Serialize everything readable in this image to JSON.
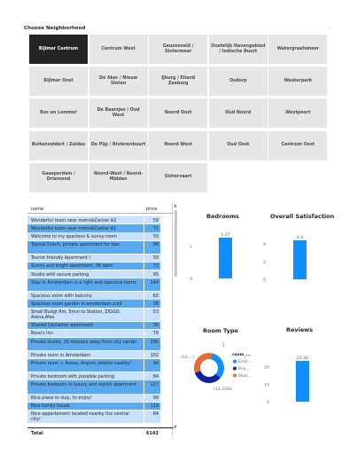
{
  "slicer": {
    "title": "Choose Neighborhood",
    "chevron": "⌵",
    "tiles": [
      {
        "label": "Bijlmer Centrum",
        "selected": true
      },
      {
        "label": "Centrum West"
      },
      {
        "label": "Geuzenveld / Slotermeer"
      },
      {
        "label": "Oostelijk Havengebied / Indische Buurt"
      },
      {
        "label": "Watergraafsmeer"
      },
      {
        "label": "Bijlmer Oost"
      },
      {
        "label": "De Aker / Nieuw Sloten"
      },
      {
        "label": "IJburg / Eiland Zeeburg"
      },
      {
        "label": "Osdorp"
      },
      {
        "label": "Westerpark"
      },
      {
        "label": "Bos en Lommer"
      },
      {
        "label": "De Baarsjes / Oud West"
      },
      {
        "label": "Noord Oost"
      },
      {
        "label": "Oud Noord"
      },
      {
        "label": "Westpoort"
      },
      {
        "label": "Buitenveldert / Zuidas"
      },
      {
        "label": "De Pijp / Rivierenbuurt"
      },
      {
        "label": "Noord West"
      },
      {
        "label": "Oud Oost"
      },
      {
        "label": "Centrum Oost"
      },
      {
        "label": "Gaasperdam / Driemond"
      },
      {
        "label": "Noord-West / Noord-Midden"
      },
      {
        "label": "Slotervaart"
      }
    ]
  },
  "table": {
    "col_name": "name",
    "col_price": "price",
    "rows": [
      {
        "name": "Wonderful room near metro&Center A2",
        "price": "59"
      },
      {
        "name": "Wonderful room near metro&Center A1",
        "price": "71"
      },
      {
        "name": "Welcome to my spacious & sunny room",
        "price": "59"
      },
      {
        "name": "Typical Dutch, private apartment for two.",
        "price": "96"
      },
      {
        "name": "Tourist friendly Apartment !",
        "price": "50"
      },
      {
        "name": "Sunny and bright apartment, 36 sqm!",
        "price": "72"
      },
      {
        "name": "Studio with secure parking",
        "price": "95"
      },
      {
        "name": "Stay in Amsterdam in a light and spacious home",
        "price": "144"
      },
      {
        "name": "Spacious room with balcony",
        "price": "60"
      },
      {
        "name": "Spacious room garden in amsterdam zuid",
        "price": "36"
      },
      {
        "name": "Small Budgt Rm, 5min to Station, ZIGGO, Arena,Afas",
        "price": "53"
      },
      {
        "name": "Shared Container apartment",
        "price": "30"
      },
      {
        "name": "Rose's Inn",
        "price": "78"
      },
      {
        "name": "Private studio, 20 minutes away from city center",
        "price": "156"
      },
      {
        "name": "Private room in Amsterdam",
        "price": "102"
      },
      {
        "name": "Private room > Arena, Airport, station nearby!",
        "price": "90"
      },
      {
        "name": "Private bedroom with possible parking",
        "price": "84"
      },
      {
        "name": "Private bedroom in luxury and stylish apartment",
        "price": "127"
      },
      {
        "name": "Nice place to stay, to enjoy!",
        "price": "99"
      },
      {
        "name": "Nice family house",
        "price": "119"
      },
      {
        "name": "Nice appartement located nearby the central city!",
        "price": "84"
      }
    ],
    "total_label": "Total",
    "total_value": "6143",
    "scroll_up": "▲",
    "scroll_down": "▼"
  },
  "charts": {
    "bedrooms": {
      "title": "Bedrooms"
    },
    "satisfaction": {
      "title": "Overall Satisfaction"
    },
    "room_type": {
      "title": "Room Type"
    },
    "reviews": {
      "title": "Reviews"
    }
  },
  "colors": {
    "accent": "#118dff",
    "pie_orange": "#e66c37",
    "pie_navy": "#12239e",
    "selected_tile": "#252423"
  },
  "chart_data": [
    {
      "type": "bar",
      "title": "Bedrooms",
      "categories": [
        ""
      ],
      "values": [
        1.27
      ],
      "data_labels": [
        "1.27"
      ],
      "yticks": [
        "0",
        "1"
      ],
      "ylim": [
        0,
        1.6
      ],
      "grid": false
    },
    {
      "type": "bar",
      "title": "Overall Satisfaction",
      "categories": [
        ""
      ],
      "values": [
        4.4
      ],
      "data_labels": [
        "4.4"
      ],
      "yticks": [
        "0",
        "2",
        "4"
      ],
      "ylim": [
        0,
        5
      ],
      "grid": false
    },
    {
      "type": "pie",
      "title": "Room Type",
      "donut": true,
      "labels": [
        "Entir...",
        "Priv...",
        "Shar..."
      ],
      "values": [
        33.33,
        33.33,
        33.33
      ],
      "colors": [
        "#118dff",
        "#12239e",
        "#e66c37"
      ],
      "data_labels": [
        "(33....)",
        "1",
        "(33.33%)"
      ],
      "legend_title": "room_...",
      "legend_position": "right"
    },
    {
      "type": "bar",
      "title": "Reviews",
      "categories": [
        ""
      ],
      "values": [
        23.44
      ],
      "data_labels": [
        "23.44"
      ],
      "yticks": [
        "0",
        "10",
        "20"
      ],
      "ylim": [
        0,
        30
      ],
      "grid": false
    }
  ]
}
